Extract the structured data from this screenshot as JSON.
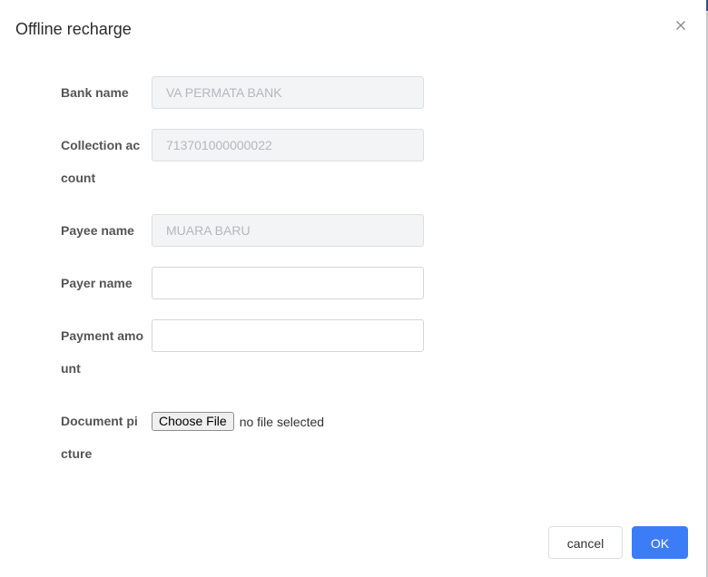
{
  "dialog": {
    "title": "Offline recharge",
    "close_icon": "close-icon"
  },
  "form": {
    "bank_name": {
      "label": "Bank name",
      "value": "VA PERMATA BANK",
      "disabled": true
    },
    "collection_account": {
      "label": "Collection account",
      "value": "713701000000022",
      "disabled": true
    },
    "payee_name": {
      "label": "Payee name",
      "value": "MUARA BARU",
      "disabled": true
    },
    "payer_name": {
      "label": "Payer name",
      "value": "",
      "placeholder": ""
    },
    "payment_amount": {
      "label": "Payment amount",
      "value": "",
      "placeholder": ""
    },
    "document_picture": {
      "label": "Document picture",
      "button_label": "Choose File",
      "status": "no file selected"
    }
  },
  "footer": {
    "cancel_label": "cancel",
    "ok_label": "OK"
  },
  "colors": {
    "primary": "#3d7cf7",
    "disabled_bg": "#f3f4f6",
    "disabled_text": "#b4b7bd",
    "label_text": "#555555"
  }
}
